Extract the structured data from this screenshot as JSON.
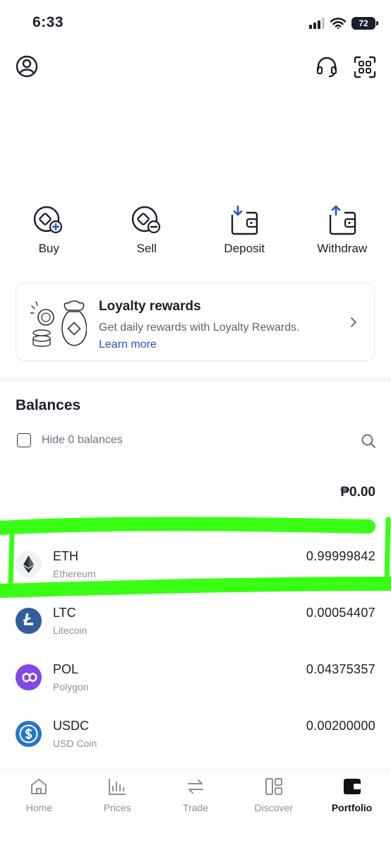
{
  "status": {
    "time": "6:33",
    "battery": "72"
  },
  "header": {
    "profile_icon": "user-circle-icon",
    "support_icon": "headset-icon",
    "scan_icon": "qr-scan-icon"
  },
  "actions": [
    {
      "label": "Buy",
      "icon": "buy-icon"
    },
    {
      "label": "Sell",
      "icon": "sell-icon"
    },
    {
      "label": "Deposit",
      "icon": "deposit-icon"
    },
    {
      "label": "Withdraw",
      "icon": "withdraw-icon"
    }
  ],
  "loyalty": {
    "title": "Loyalty rewards",
    "subtitle": "Get daily rewards with Loyalty Rewards.",
    "link": "Learn more"
  },
  "balances": {
    "heading": "Balances",
    "hide_label": "Hide 0 balances",
    "hide_checked": false,
    "total": "₱0.00",
    "assets": [
      {
        "symbol": "ETH",
        "name": "Ethereum",
        "amount": "0.99999842"
      },
      {
        "symbol": "LTC",
        "name": "Litecoin",
        "amount": "0.00054407"
      },
      {
        "symbol": "POL",
        "name": "Polygon",
        "amount": "0.04375357"
      },
      {
        "symbol": "USDC",
        "name": "USD Coin",
        "amount": "0.00200000"
      }
    ]
  },
  "nav": [
    {
      "label": "Home",
      "icon": "home-icon",
      "active": false
    },
    {
      "label": "Prices",
      "icon": "bar-chart-icon",
      "active": false
    },
    {
      "label": "Trade",
      "icon": "swap-arrows-icon",
      "active": false
    },
    {
      "label": "Discover",
      "icon": "grid-icon",
      "active": false
    },
    {
      "label": "Portfolio",
      "icon": "wallet-icon",
      "active": true
    }
  ],
  "colors": {
    "accent": "#1e55d6",
    "highlight": "#39ff14",
    "eth": "#f0f1f3",
    "ltc": "#345d9d",
    "pol": "#8247e5",
    "usdc": "#2775ca"
  }
}
